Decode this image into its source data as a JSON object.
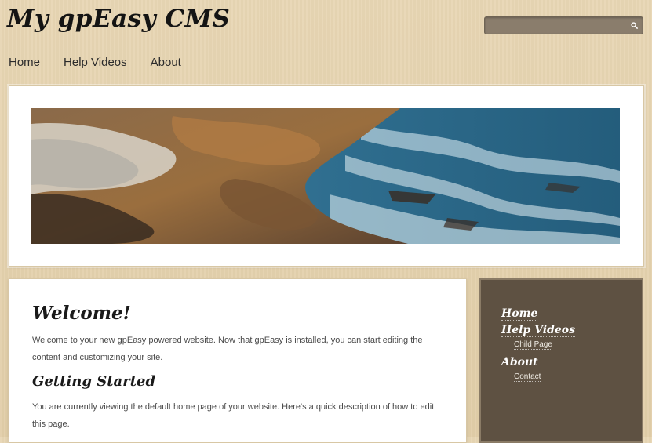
{
  "site": {
    "title": "My gpEasy CMS"
  },
  "search": {
    "placeholder": "",
    "icon": "search-icon"
  },
  "nav": {
    "items": [
      "Home",
      "Help Videos",
      "About"
    ]
  },
  "banner": {
    "description": "rocky coastline with ocean waves"
  },
  "content": {
    "heading": "Welcome!",
    "intro": "Welcome to your new gpEasy powered website. Now that gpEasy is installed, you can start editing the content and customizing your site.",
    "subheading": "Getting Started",
    "body": "You are currently viewing the default home page of your website. Here's a quick description of how to edit this page."
  },
  "sidebar": {
    "items": [
      {
        "label": "Home"
      },
      {
        "label": "Help Videos"
      },
      {
        "label": "Child Page"
      },
      {
        "label": "About"
      },
      {
        "label": "Contact"
      }
    ]
  },
  "colors": {
    "background": "#e5d2ae",
    "sidebar_bg": "#5e5142",
    "search_bg": "#8a7d6c",
    "text": "#333333"
  }
}
